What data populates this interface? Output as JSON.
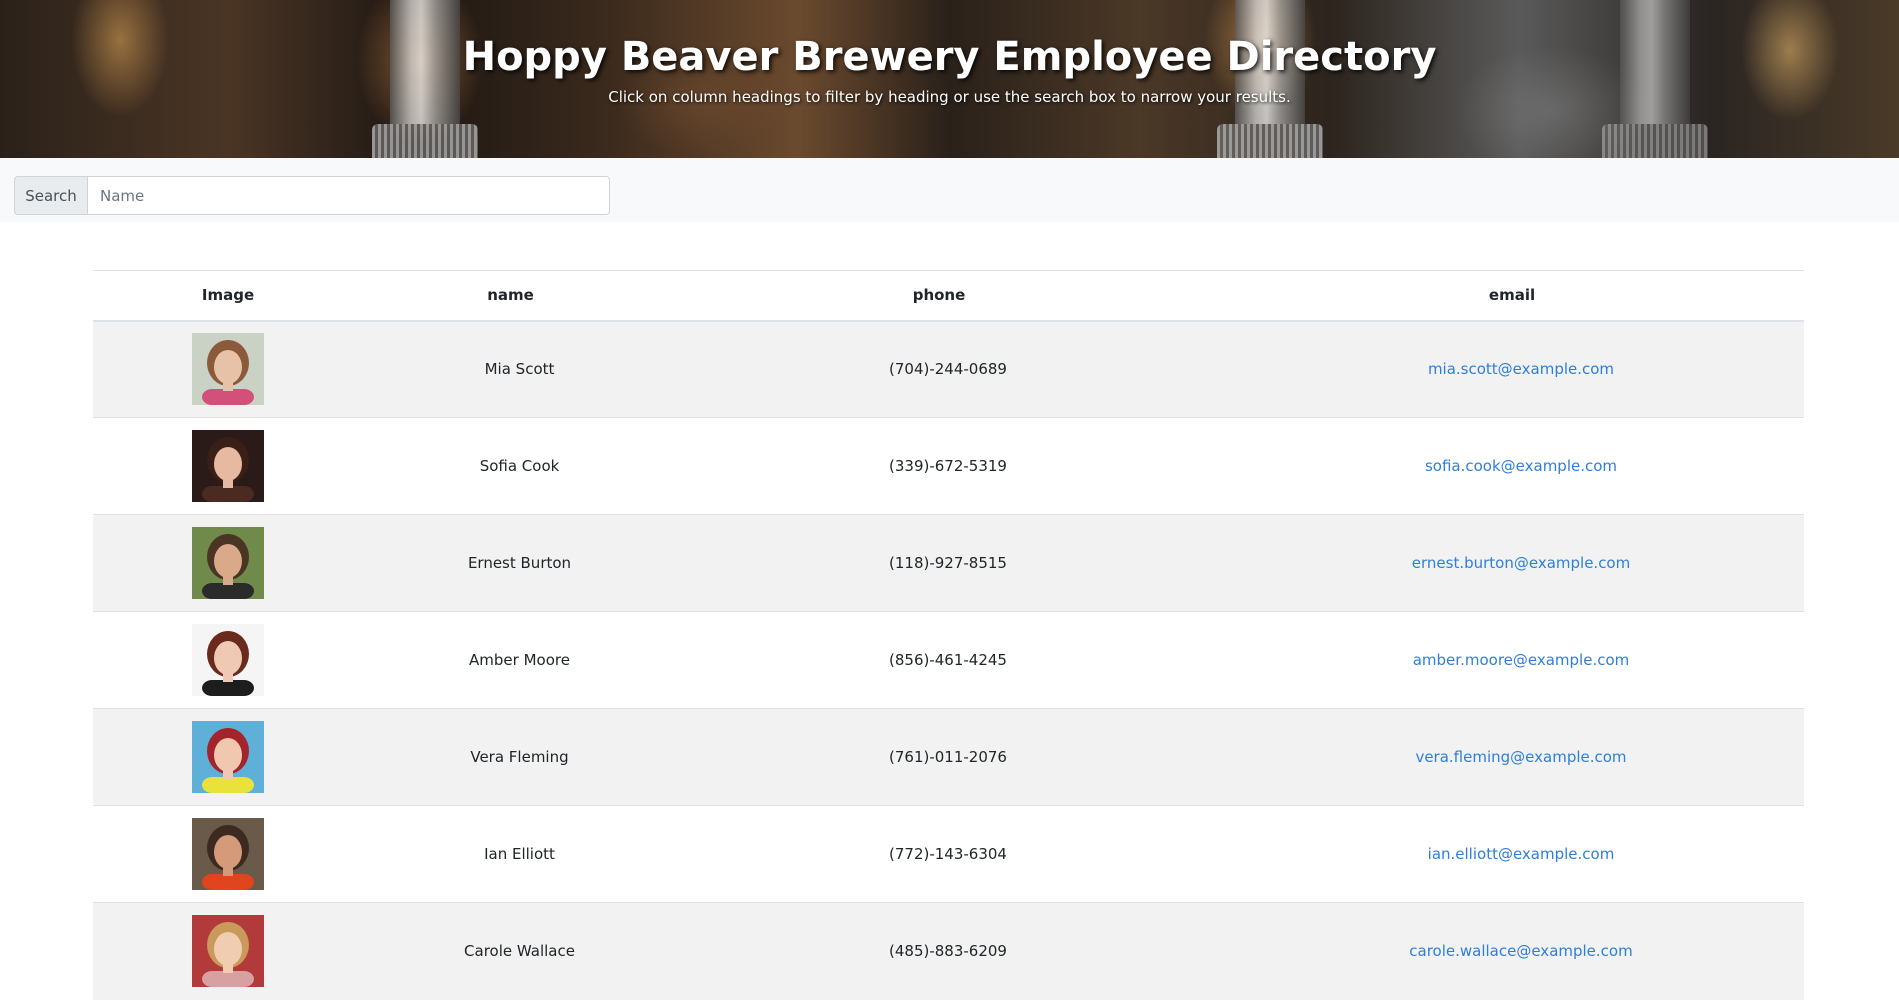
{
  "header": {
    "title": "Hoppy Beaver Brewery Employee Directory",
    "subtitle": "Click on column headings to filter by heading or use the search box to narrow your results."
  },
  "search": {
    "label": "Search",
    "placeholder": "Name",
    "value": ""
  },
  "table": {
    "columns": [
      "Image",
      "name",
      "phone",
      "email"
    ],
    "rows": [
      {
        "name": "Mia Scott",
        "phone": "(704)-244-0689",
        "email": "mia.scott@example.com",
        "avatar": {
          "bg": "#c9d2c4",
          "skin": "#e8c2a8",
          "hair": "#8a5a3a",
          "shirt": "#d2507a"
        }
      },
      {
        "name": "Sofia Cook",
        "phone": "(339)-672-5319",
        "email": "sofia.cook@example.com",
        "avatar": {
          "bg": "#2a1a18",
          "skin": "#e6b9a0",
          "hair": "#3a1f17",
          "shirt": "#4b2a22"
        }
      },
      {
        "name": "Ernest Burton",
        "phone": "(118)-927-8515",
        "email": "ernest.burton@example.com",
        "avatar": {
          "bg": "#6f8a4a",
          "skin": "#d9a98a",
          "hair": "#4a3424",
          "shirt": "#2b2b2b"
        }
      },
      {
        "name": "Amber Moore",
        "phone": "(856)-461-4245",
        "email": "amber.moore@example.com",
        "avatar": {
          "bg": "#f5f5f5",
          "skin": "#efc9b4",
          "hair": "#6b2a1e",
          "shirt": "#1d1d1d"
        }
      },
      {
        "name": "Vera Fleming",
        "phone": "(761)-011-2076",
        "email": "vera.fleming@example.com",
        "avatar": {
          "bg": "#5fb0d8",
          "skin": "#f0c8b0",
          "hair": "#a3242a",
          "shirt": "#e8e23a"
        }
      },
      {
        "name": "Ian Elliott",
        "phone": "(772)-143-6304",
        "email": "ian.elliott@example.com",
        "avatar": {
          "bg": "#6a5a4a",
          "skin": "#d49a7a",
          "hair": "#3a2a20",
          "shirt": "#e0451e"
        }
      },
      {
        "name": "Carole Wallace",
        "phone": "(485)-883-6209",
        "email": "carole.wallace@example.com",
        "avatar": {
          "bg": "#b33a3a",
          "skin": "#f0ccb0",
          "hair": "#c99a5a",
          "shirt": "#d8a0a0"
        }
      }
    ]
  }
}
